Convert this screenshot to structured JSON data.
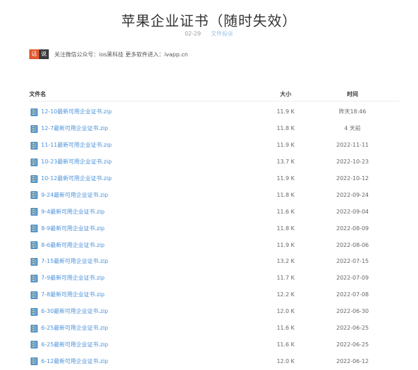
{
  "page": {
    "title": "苹果企业证书（随时失效）",
    "date": "02-29",
    "category": "文件投诉"
  },
  "notice": {
    "badge_left": "话",
    "badge_right": "说",
    "text": "关注微信公众号：ios黑科技 更多软件进入：ivapp.cn"
  },
  "table": {
    "headers": {
      "name": "文件名",
      "size": "大小",
      "time": "时间"
    },
    "rows": [
      {
        "name": "12-10最新可用企业证书.zip",
        "size": "11.9 K",
        "time": "昨天18:46"
      },
      {
        "name": "12-7最新可用企业证书.zip",
        "size": "11.8 K",
        "time": "4 天前"
      },
      {
        "name": "11-11最新可用企业证书.zip",
        "size": "11.9 K",
        "time": "2022-11-11"
      },
      {
        "name": "10-23最新可用企业证书.zip",
        "size": "13.7 K",
        "time": "2022-10-23"
      },
      {
        "name": "10-12最新可用企业证书.zip",
        "size": "11.9 K",
        "time": "2022-10-12"
      },
      {
        "name": "9-24最新可用企业证书.zip",
        "size": "11.8 K",
        "time": "2022-09-24"
      },
      {
        "name": "9-4最新可用企业证书.zip",
        "size": "11.6 K",
        "time": "2022-09-04"
      },
      {
        "name": "8-9最新可用企业证书.zip",
        "size": "11.8 K",
        "time": "2022-08-09"
      },
      {
        "name": "8-6最新可用企业证书.zip",
        "size": "11.9 K",
        "time": "2022-08-06"
      },
      {
        "name": "7-15最新可用企业证书.zip",
        "size": "13.2 K",
        "time": "2022-07-15"
      },
      {
        "name": "7-9最新可用企业证书.zip",
        "size": "11.7 K",
        "time": "2022-07-09"
      },
      {
        "name": "7-8最新可用企业证书.zip",
        "size": "12.2 K",
        "time": "2022-07-08"
      },
      {
        "name": "6-30最新可用企业证书.zip",
        "size": "12.0 K",
        "time": "2022-06-30"
      },
      {
        "name": "6-25最新可用企业证书.zip",
        "size": "11.6 K",
        "time": "2022-06-25"
      },
      {
        "name": "6-25最新可用企业证书.zip",
        "size": "11.6 K",
        "time": "2022-06-25"
      },
      {
        "name": "6-12最新可用企业证书.zip",
        "size": "12.0 K",
        "time": "2022-06-12"
      }
    ]
  }
}
